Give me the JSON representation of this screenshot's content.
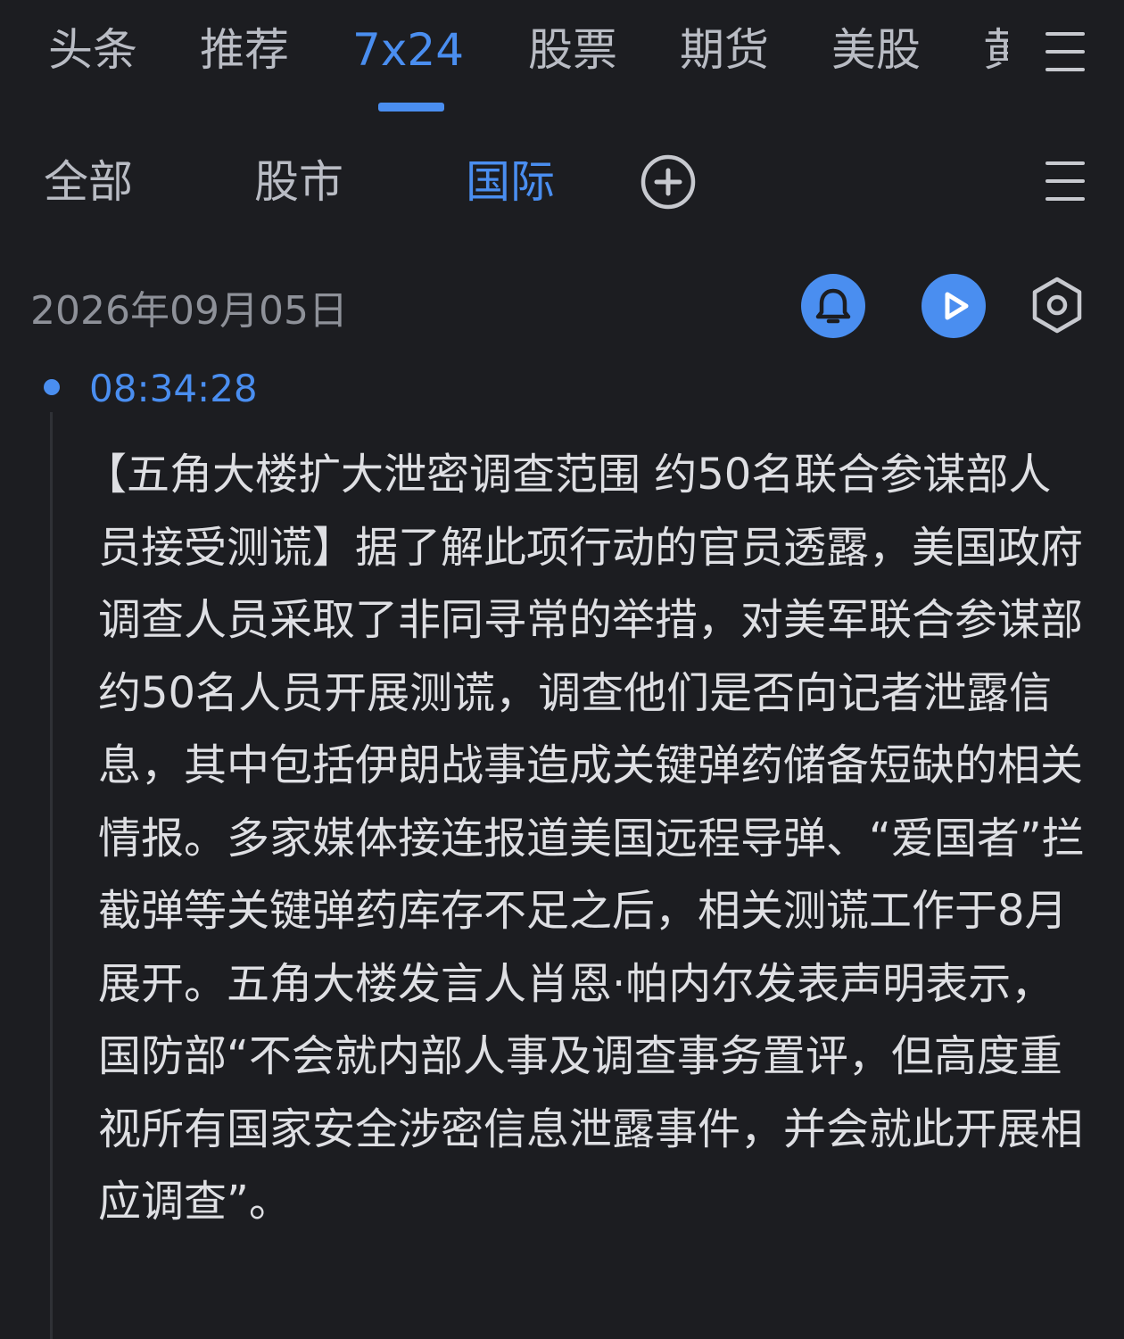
{
  "top_tabs": {
    "items": [
      {
        "label": "头条",
        "active": false
      },
      {
        "label": "推荐",
        "active": false
      },
      {
        "label": "7x24",
        "active": true
      },
      {
        "label": "股票",
        "active": false
      },
      {
        "label": "期货",
        "active": false
      },
      {
        "label": "美股",
        "active": false
      },
      {
        "label": "黄",
        "active": false
      }
    ]
  },
  "sub_tabs": {
    "items": [
      {
        "label": "全部",
        "active": false
      },
      {
        "label": "股市",
        "active": false
      },
      {
        "label": "国际",
        "active": true
      }
    ]
  },
  "icons": {
    "top_menu": "menu-icon",
    "sub_menu": "menu-icon",
    "add": "add-circle-icon",
    "bell": "bell-icon",
    "play": "play-icon",
    "settings": "hexagon-settings-icon"
  },
  "colors": {
    "accent": "#4a8ef0",
    "background": "#1c1d21",
    "text": "#dedfe3",
    "muted": "#8e9199"
  },
  "feed": {
    "date": "2026年09月05日",
    "item": {
      "time": "08:34:28",
      "headline": "【五角大楼扩大泄密调查范围 约50名联合参谋部人员接受测谎】",
      "body": "据了解此项行动的官员透露，美国政府调查人员采取了非同寻常的举措，对美军联合参谋部约50名人员开展测谎，调查他们是否向记者泄露信息，其中包括伊朗战事造成关键弹药储备短缺的相关情报。多家媒体接连报道美国远程导弹、“爱国者”拦截弹等关键弹药库存不足之后，相关测谎工作于8月展开。五角大楼发言人肖恩·帕内尔发表声明表示，国防部“不会就内部人事及调查事务置评，但高度重视所有国家安全涉密信息泄露事件，并会就此开展相应调查”。"
    }
  }
}
